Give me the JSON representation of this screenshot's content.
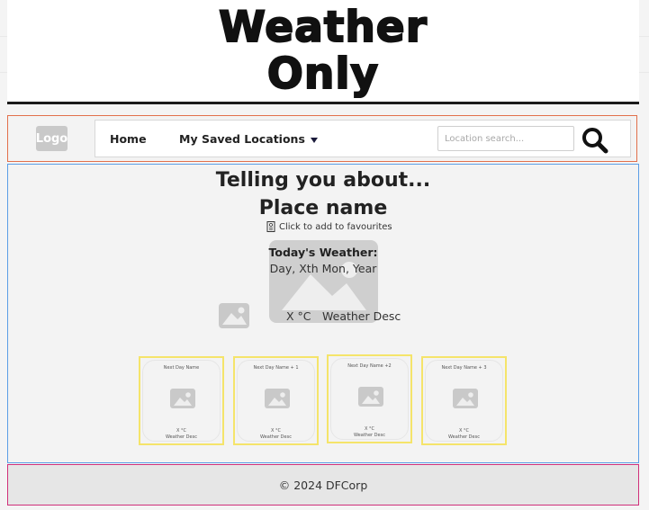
{
  "header": {
    "brand_line1": "Weather",
    "brand_line2": "Only"
  },
  "nav": {
    "logo": "Logo",
    "home": "Home",
    "saved": "My Saved Locations",
    "search_placeholder": "Location search..."
  },
  "main": {
    "tagline": "Telling you about...",
    "place": "Place name",
    "favourite": "Click to add to favourites",
    "today_label": "Today's Weather:",
    "date": "Day, Xth Mon, Year",
    "temp": "X °C",
    "desc": "Weather Desc"
  },
  "forecast": [
    {
      "name": "Next Day Name",
      "temp": "X °C",
      "desc": "Weather Desc"
    },
    {
      "name": "Next Day Name + 1",
      "temp": "X °C",
      "desc": "Weather Desc"
    },
    {
      "name": "Next Day Name +2",
      "temp": "X °C",
      "desc": "Weather Desc"
    },
    {
      "name": "Next Day Name + 3",
      "temp": "X °C",
      "desc": "Weather Desc"
    }
  ],
  "footer": {
    "text": "©  2024 DFCorp"
  },
  "colors": {
    "nav_border": "#e2704b",
    "main_border": "#5b9ee6",
    "footer_border": "#d0307a",
    "card_border": "#f5e46a"
  }
}
